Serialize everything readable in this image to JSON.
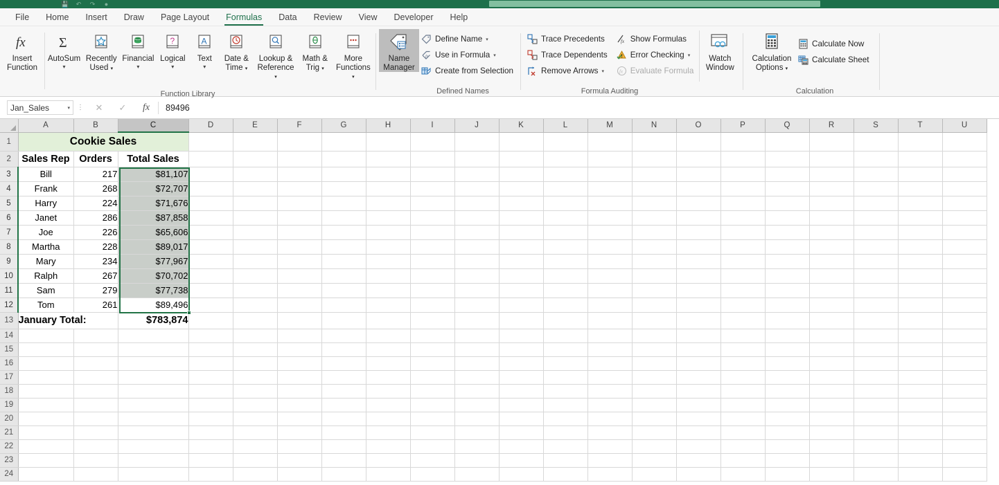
{
  "titlebar": {
    "quick_access_icons": [
      "save-icon",
      "undo-icon",
      "redo-icon",
      "autosave-icon"
    ],
    "search_placeholder": ""
  },
  "tabs": [
    {
      "label": "File",
      "active": false
    },
    {
      "label": "Home",
      "active": false
    },
    {
      "label": "Insert",
      "active": false
    },
    {
      "label": "Draw",
      "active": false
    },
    {
      "label": "Page Layout",
      "active": false
    },
    {
      "label": "Formulas",
      "active": true
    },
    {
      "label": "Data",
      "active": false
    },
    {
      "label": "Review",
      "active": false
    },
    {
      "label": "View",
      "active": false
    },
    {
      "label": "Developer",
      "active": false
    },
    {
      "label": "Help",
      "active": false
    }
  ],
  "ribbon": {
    "groups": [
      {
        "name": "Function Library",
        "label": "Function Library",
        "buttons": [
          {
            "label": "Insert",
            "label2": "Function",
            "icon": "fx-icon",
            "caret": false
          },
          {
            "label": "AutoSum",
            "label2": "",
            "icon": "sigma-icon",
            "caret": true
          },
          {
            "label": "Recently",
            "label2": "Used",
            "icon": "star-icon",
            "caret": true
          },
          {
            "label": "Financial",
            "label2": "",
            "icon": "coins-icon",
            "caret": true
          },
          {
            "label": "Logical",
            "label2": "",
            "icon": "question-icon",
            "caret": true
          },
          {
            "label": "Text",
            "label2": "",
            "icon": "letter-a-icon",
            "caret": true
          },
          {
            "label": "Date &",
            "label2": "Time",
            "icon": "clock-icon",
            "caret": true
          },
          {
            "label": "Lookup &",
            "label2": "Reference",
            "icon": "magnifier-icon",
            "caret": true
          },
          {
            "label": "Math &",
            "label2": "Trig",
            "icon": "theta-icon",
            "caret": true
          },
          {
            "label": "More",
            "label2": "Functions",
            "icon": "ellipsis-icon",
            "caret": true
          }
        ]
      },
      {
        "name": "Defined Names",
        "label": "Defined Names",
        "big_button": {
          "label": "Name",
          "label2": "Manager",
          "icon": "name-tag-icon",
          "selected": true
        },
        "small_buttons": [
          {
            "label": "Define Name",
            "icon": "tag-icon",
            "caret": true,
            "disabled": false
          },
          {
            "label": "Use in Formula",
            "icon": "tag-fx-icon",
            "caret": true,
            "disabled": false
          },
          {
            "label": "Create from Selection",
            "icon": "create-selection-icon",
            "caret": false,
            "disabled": false
          }
        ]
      },
      {
        "name": "Formula Auditing",
        "label": "Formula Auditing",
        "col_a": [
          {
            "label": "Trace Precedents",
            "icon": "trace-precedents-icon",
            "caret": false,
            "disabled": false
          },
          {
            "label": "Trace Dependents",
            "icon": "trace-dependents-icon",
            "caret": false,
            "disabled": false
          },
          {
            "label": "Remove Arrows",
            "icon": "remove-arrows-icon",
            "caret": true,
            "disabled": false
          }
        ],
        "col_b": [
          {
            "label": "Show Formulas",
            "icon": "show-formulas-icon",
            "caret": false,
            "disabled": false
          },
          {
            "label": "Error Checking",
            "icon": "error-checking-icon",
            "caret": true,
            "disabled": false
          },
          {
            "label": "Evaluate Formula",
            "icon": "evaluate-formula-icon",
            "caret": false,
            "disabled": true
          }
        ],
        "watch_window": {
          "label": "Watch",
          "label2": "Window",
          "icon": "watch-window-icon"
        }
      },
      {
        "name": "Calculation",
        "label": "Calculation",
        "big_button": {
          "label": "Calculation",
          "label2": "Options",
          "icon": "calculator-icon",
          "caret": true
        },
        "small_buttons": [
          {
            "label": "Calculate Now",
            "icon": "calculate-now-icon",
            "caret": false,
            "disabled": false
          },
          {
            "label": "Calculate Sheet",
            "icon": "calculate-sheet-icon",
            "caret": false,
            "disabled": false
          }
        ]
      }
    ]
  },
  "formula_bar": {
    "name_box_value": "Jan_Sales",
    "name_box_placeholder": "Name Box",
    "cancel_icon": "cancel-x-icon",
    "enter_icon": "enter-check-icon",
    "fx_icon": "insert-function-icon",
    "formula_value": "89496",
    "formula_placeholder": ""
  },
  "grid": {
    "column_headers": [
      "A",
      "B",
      "C",
      "D",
      "E",
      "F",
      "G",
      "H",
      "I",
      "J",
      "K",
      "L",
      "M",
      "N",
      "O",
      "P",
      "Q",
      "R",
      "S",
      "T",
      "U"
    ],
    "selected_column": "C",
    "row_numbers": [
      1,
      2,
      3,
      4,
      5,
      6,
      7,
      8,
      9,
      10,
      11,
      12,
      13,
      14,
      15,
      16,
      17,
      18,
      19,
      20,
      21,
      22,
      23,
      24
    ],
    "selected_rows": [
      3,
      4,
      5,
      6,
      7,
      8,
      9,
      10,
      11,
      12
    ],
    "selection_range": "C3:C12",
    "active_cell": "C12",
    "accent_color": "#217346",
    "selection_fill": "#c9cec9",
    "title_fill": "#e2f0d9",
    "title_row": {
      "text": "Cookie Sales",
      "merge_from": "A1",
      "merge_to": "C1"
    },
    "headers": [
      "Sales Rep",
      "Orders",
      "Total Sales"
    ],
    "rows": [
      {
        "row": 3,
        "rep": "Bill",
        "orders": "217",
        "total": "$81,107"
      },
      {
        "row": 4,
        "rep": "Frank",
        "orders": "268",
        "total": "$72,707"
      },
      {
        "row": 5,
        "rep": "Harry",
        "orders": "224",
        "total": "$71,676"
      },
      {
        "row": 6,
        "rep": "Janet",
        "orders": "286",
        "total": "$87,858"
      },
      {
        "row": 7,
        "rep": "Joe",
        "orders": "226",
        "total": "$65,606"
      },
      {
        "row": 8,
        "rep": "Martha",
        "orders": "228",
        "total": "$89,017"
      },
      {
        "row": 9,
        "rep": "Mary",
        "orders": "234",
        "total": "$77,967"
      },
      {
        "row": 10,
        "rep": "Ralph",
        "orders": "267",
        "total": "$70,702"
      },
      {
        "row": 11,
        "rep": "Sam",
        "orders": "279",
        "total": "$77,738"
      },
      {
        "row": 12,
        "rep": "Tom",
        "orders": "261",
        "total": "$89,496"
      }
    ],
    "total_row": {
      "row": 13,
      "label": "January Total:",
      "value": "$783,874"
    }
  }
}
